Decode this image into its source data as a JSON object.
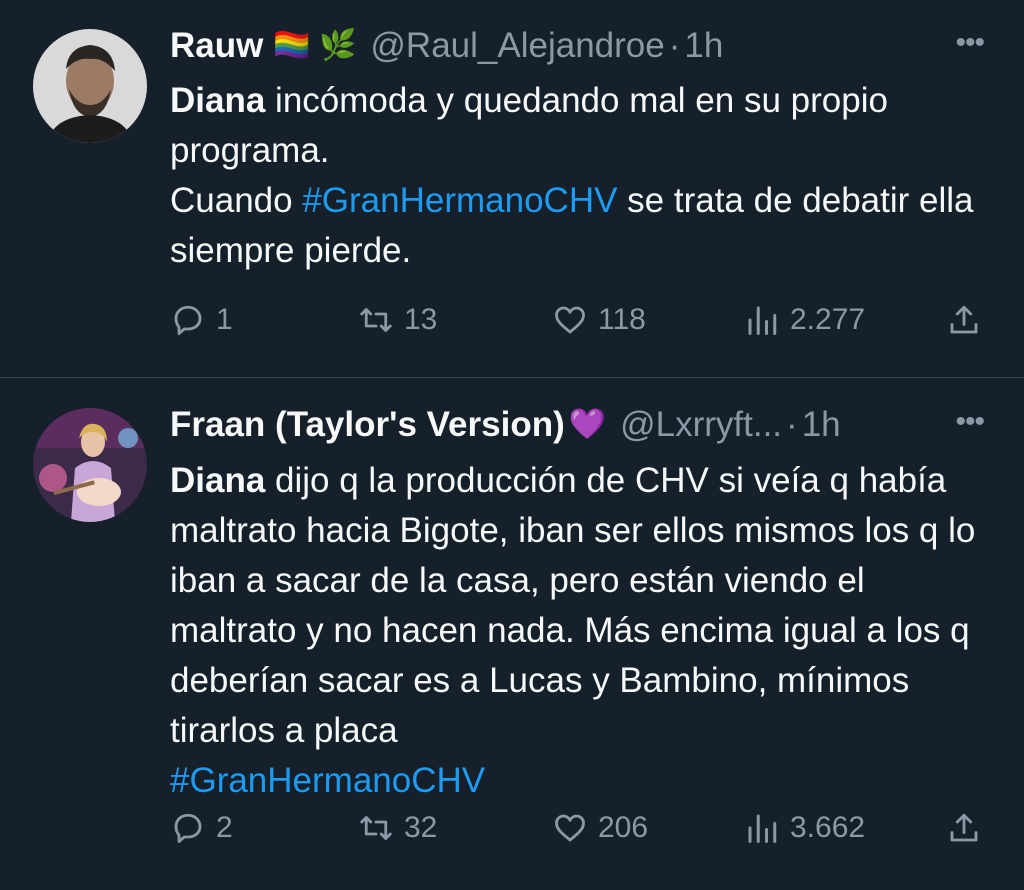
{
  "tweets": [
    {
      "name": "Rauw",
      "emoji": "🏳️‍🌈 🌿",
      "handle": "@Raul_Alejandroe",
      "sep": "·",
      "time": "1h",
      "more": "•••",
      "body": {
        "line1_bold": "Diana",
        "line1_rest": " incómoda y quedando mal en su propio programa.",
        "line2_pre": "Cuando ",
        "hashtag": "#GranHermanoCHV",
        "line2_post": " se trata de debatir ella siempre pierde."
      },
      "actions": {
        "replies": "1",
        "retweets": "13",
        "likes": "118",
        "views": "2.277"
      }
    },
    {
      "name": "Fraan (Taylor's Version)",
      "emoji": "💜",
      "handle": "@Lxrryft...",
      "sep": "·",
      "time": "1h",
      "more": "•••",
      "body": {
        "line1_bold": "Diana",
        "line1_rest": " dijo q la producción de CHV si veía q había maltrato hacia Bigote, iban ser ellos mismos los q lo iban a sacar de la casa, pero están viendo el maltrato y no hacen nada. Más encima igual a los q deberían sacar es a Lucas y Bambino, mínimos tirarlos a placa",
        "hashtag": "#GranHermanoCHV"
      },
      "actions": {
        "replies": "2",
        "retweets": "32",
        "likes": "206",
        "views": "3.662"
      }
    }
  ],
  "colors": {
    "background": "#15202b",
    "text": "#f7f9f9",
    "muted": "#8b98a5",
    "link": "#1d9bf0",
    "divider": "#38444d"
  },
  "icons": [
    "reply-icon",
    "retweet-icon",
    "like-icon",
    "views-icon",
    "share-icon",
    "more-icon"
  ]
}
